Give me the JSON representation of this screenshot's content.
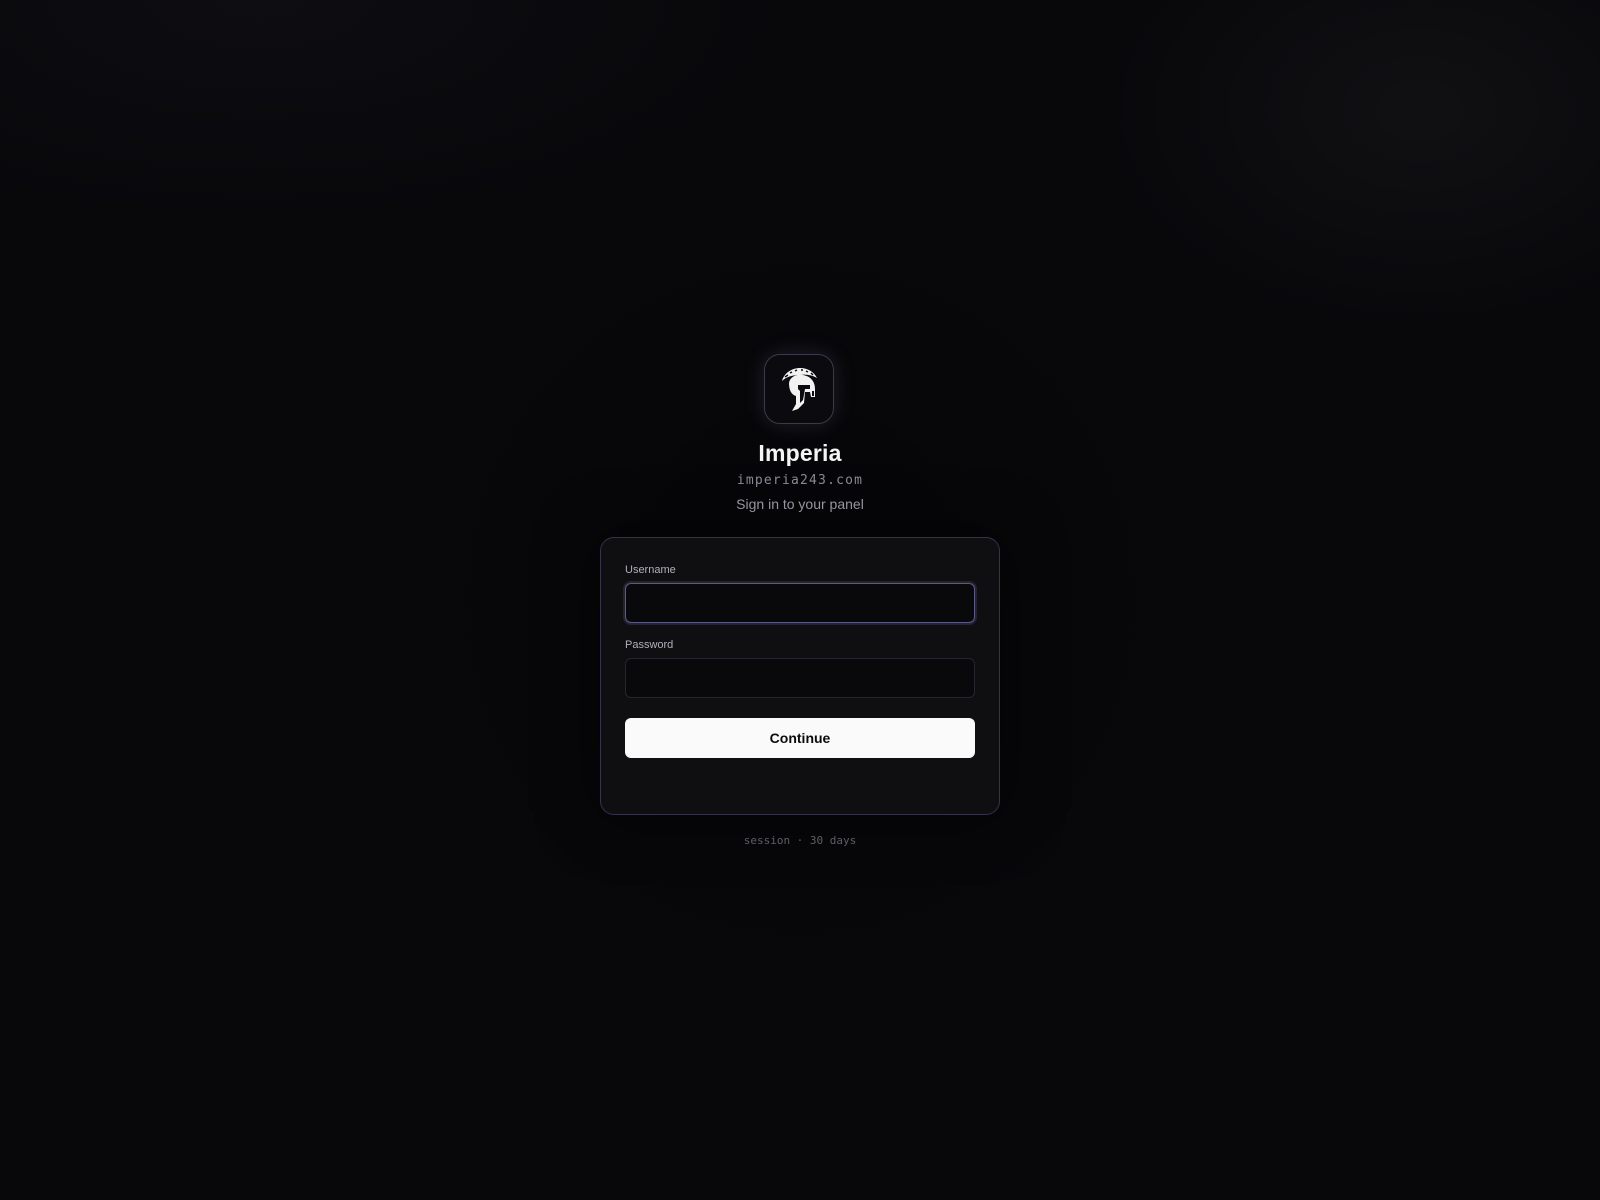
{
  "brand": {
    "name": "Imperia",
    "domain": "imperia243.com",
    "tagline": "Sign in to your panel",
    "logo_icon": "spartan-helmet-icon"
  },
  "form": {
    "username_label": "Username",
    "username_value": "",
    "password_label": "Password",
    "password_value": "",
    "submit_label": "Continue"
  },
  "footer": {
    "text": "session · 30 days"
  },
  "colors": {
    "background": "#08080b",
    "card": "#0f0f12",
    "card_border": "#34344a",
    "focus_border": "#5c5a86",
    "button": "#fafafa",
    "button_text": "#0c0c0e"
  }
}
